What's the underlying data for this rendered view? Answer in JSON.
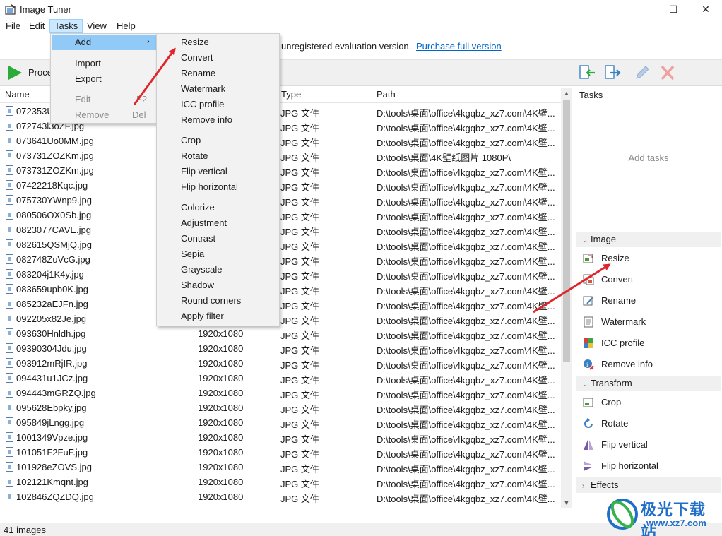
{
  "window": {
    "title": "Image Tuner",
    "minimize": "—",
    "maximize": "☐",
    "close": "✕"
  },
  "menubar": {
    "items": [
      "File",
      "Edit",
      "Tasks",
      "View",
      "Help"
    ],
    "active": "Tasks"
  },
  "infobar": {
    "text": "unregistered evaluation version.",
    "link": "Purchase full version"
  },
  "toolbar": {
    "process_label": "Proce",
    "icons": [
      "import-list-icon",
      "export-list-icon",
      "edit-pencil-icon",
      "delete-x-icon"
    ]
  },
  "tasks_menu": {
    "items": [
      {
        "label": "Add",
        "shortcut": "",
        "enabled": true,
        "submenu": true
      },
      {
        "label": "Import",
        "shortcut": "",
        "enabled": true
      },
      {
        "label": "Export",
        "shortcut": "",
        "enabled": true
      },
      {
        "label": "Edit",
        "shortcut": "F2",
        "enabled": false
      },
      {
        "label": "Remove",
        "shortcut": "Del",
        "enabled": false
      }
    ]
  },
  "add_submenu": {
    "groups": [
      [
        "Resize",
        "Convert",
        "Rename",
        "Watermark",
        "ICC profile",
        "Remove info"
      ],
      [
        "Crop",
        "Rotate",
        "Flip vertical",
        "Flip horizontal"
      ],
      [
        "Colorize",
        "Adjustment",
        "Contrast",
        "Sepia",
        "Grayscale",
        "Shadow",
        "Round corners",
        "Apply filter"
      ]
    ]
  },
  "filelist": {
    "columns": [
      "Name",
      "",
      "Type",
      "Path"
    ],
    "rows": [
      {
        "name": "072353U",
        "size": "",
        "type": "JPG 文件",
        "path": "D:\\tools\\桌面\\office\\4kgqbz_xz7.com\\4K壁..."
      },
      {
        "name": "072743l3oZF.jpg",
        "size": "",
        "type": "JPG 文件",
        "path": "D:\\tools\\桌面\\office\\4kgqbz_xz7.com\\4K壁..."
      },
      {
        "name": "073641Uo0MM.jpg",
        "size": "",
        "type": "JPG 文件",
        "path": "D:\\tools\\桌面\\office\\4kgqbz_xz7.com\\4K壁..."
      },
      {
        "name": "073731ZOZKm.jpg",
        "size": "",
        "type": "JPG 文件",
        "path": "D:\\tools\\桌面\\4K壁纸图片 1080P\\"
      },
      {
        "name": "073731ZOZKm.jpg",
        "size": "",
        "type": "JPG 文件",
        "path": "D:\\tools\\桌面\\office\\4kgqbz_xz7.com\\4K壁..."
      },
      {
        "name": "07422218Kqc.jpg",
        "size": "",
        "type": "JPG 文件",
        "path": "D:\\tools\\桌面\\office\\4kgqbz_xz7.com\\4K壁..."
      },
      {
        "name": "075730YWnp9.jpg",
        "size": "",
        "type": "JPG 文件",
        "path": "D:\\tools\\桌面\\office\\4kgqbz_xz7.com\\4K壁..."
      },
      {
        "name": "080506OX0Sb.jpg",
        "size": "",
        "type": "JPG 文件",
        "path": "D:\\tools\\桌面\\office\\4kgqbz_xz7.com\\4K壁..."
      },
      {
        "name": "0823077CAVE.jpg",
        "size": "",
        "type": "JPG 文件",
        "path": "D:\\tools\\桌面\\office\\4kgqbz_xz7.com\\4K壁..."
      },
      {
        "name": "082615QSMjQ.jpg",
        "size": "",
        "type": "JPG 文件",
        "path": "D:\\tools\\桌面\\office\\4kgqbz_xz7.com\\4K壁..."
      },
      {
        "name": "082748ZuVcG.jpg",
        "size": "",
        "type": "JPG 文件",
        "path": "D:\\tools\\桌面\\office\\4kgqbz_xz7.com\\4K壁..."
      },
      {
        "name": "083204j1K4y.jpg",
        "size": "",
        "type": "JPG 文件",
        "path": "D:\\tools\\桌面\\office\\4kgqbz_xz7.com\\4K壁..."
      },
      {
        "name": "083659upb0K.jpg",
        "size": "",
        "type": "JPG 文件",
        "path": "D:\\tools\\桌面\\office\\4kgqbz_xz7.com\\4K壁..."
      },
      {
        "name": "085232aEJFn.jpg",
        "size": "",
        "type": "JPG 文件",
        "path": "D:\\tools\\桌面\\office\\4kgqbz_xz7.com\\4K壁..."
      },
      {
        "name": "092205x82Je.jpg",
        "size": "",
        "type": "JPG 文件",
        "path": "D:\\tools\\桌面\\office\\4kgqbz_xz7.com\\4K壁..."
      },
      {
        "name": "093630Hnldh.jpg",
        "size": "1920x1080",
        "type": "JPG 文件",
        "path": "D:\\tools\\桌面\\office\\4kgqbz_xz7.com\\4K壁..."
      },
      {
        "name": "09390304Jdu.jpg",
        "size": "1920x1080",
        "type": "JPG 文件",
        "path": "D:\\tools\\桌面\\office\\4kgqbz_xz7.com\\4K壁..."
      },
      {
        "name": "093912mRjIR.jpg",
        "size": "1920x1080",
        "type": "JPG 文件",
        "path": "D:\\tools\\桌面\\office\\4kgqbz_xz7.com\\4K壁..."
      },
      {
        "name": "094431u1JCz.jpg",
        "size": "1920x1080",
        "type": "JPG 文件",
        "path": "D:\\tools\\桌面\\office\\4kgqbz_xz7.com\\4K壁..."
      },
      {
        "name": "094443mGRZQ.jpg",
        "size": "1920x1080",
        "type": "JPG 文件",
        "path": "D:\\tools\\桌面\\office\\4kgqbz_xz7.com\\4K壁..."
      },
      {
        "name": "095628Ebpky.jpg",
        "size": "1920x1080",
        "type": "JPG 文件",
        "path": "D:\\tools\\桌面\\office\\4kgqbz_xz7.com\\4K壁..."
      },
      {
        "name": "095849jLngg.jpg",
        "size": "1920x1080",
        "type": "JPG 文件",
        "path": "D:\\tools\\桌面\\office\\4kgqbz_xz7.com\\4K壁..."
      },
      {
        "name": "1001349Vpze.jpg",
        "size": "1920x1080",
        "type": "JPG 文件",
        "path": "D:\\tools\\桌面\\office\\4kgqbz_xz7.com\\4K壁..."
      },
      {
        "name": "101051F2FuF.jpg",
        "size": "1920x1080",
        "type": "JPG 文件",
        "path": "D:\\tools\\桌面\\office\\4kgqbz_xz7.com\\4K壁..."
      },
      {
        "name": "101928eZOVS.jpg",
        "size": "1920x1080",
        "type": "JPG 文件",
        "path": "D:\\tools\\桌面\\office\\4kgqbz_xz7.com\\4K壁..."
      },
      {
        "name": "102121Kmqnt.jpg",
        "size": "1920x1080",
        "type": "JPG 文件",
        "path": "D:\\tools\\桌面\\office\\4kgqbz_xz7.com\\4K壁..."
      },
      {
        "name": "102846ZQZDQ.jpg",
        "size": "1920x1080",
        "type": "JPG 文件",
        "path": "D:\\tools\\桌面\\office\\4kgqbz_xz7.com\\4K壁..."
      }
    ]
  },
  "rightpanel": {
    "title": "Tasks",
    "empty_hint": "Add tasks",
    "groups": [
      {
        "name": "Image",
        "expanded": true,
        "items": [
          {
            "label": "Resize",
            "icon": "resize-icon"
          },
          {
            "label": "Convert",
            "icon": "convert-icon"
          },
          {
            "label": "Rename",
            "icon": "rename-icon"
          },
          {
            "label": "Watermark",
            "icon": "watermark-icon"
          },
          {
            "label": "ICC profile",
            "icon": "icc-profile-icon"
          },
          {
            "label": "Remove info",
            "icon": "remove-info-icon"
          }
        ]
      },
      {
        "name": "Transform",
        "expanded": true,
        "items": [
          {
            "label": "Crop",
            "icon": "crop-icon"
          },
          {
            "label": "Rotate",
            "icon": "rotate-icon"
          },
          {
            "label": "Flip vertical",
            "icon": "flip-vertical-icon"
          },
          {
            "label": "Flip horizontal",
            "icon": "flip-horizontal-icon"
          }
        ]
      },
      {
        "name": "Effects",
        "expanded": false,
        "items": []
      }
    ]
  },
  "statusbar": {
    "text": "41 images"
  },
  "watermark": {
    "brand": "极光下载站",
    "site": "www.xz7.com"
  },
  "colors": {
    "accent": "#0066cc",
    "highlight": "#91c9f7",
    "menu_active": "#cce8ff",
    "arrow": "#e0262a",
    "process_green": "#2bab3a"
  }
}
